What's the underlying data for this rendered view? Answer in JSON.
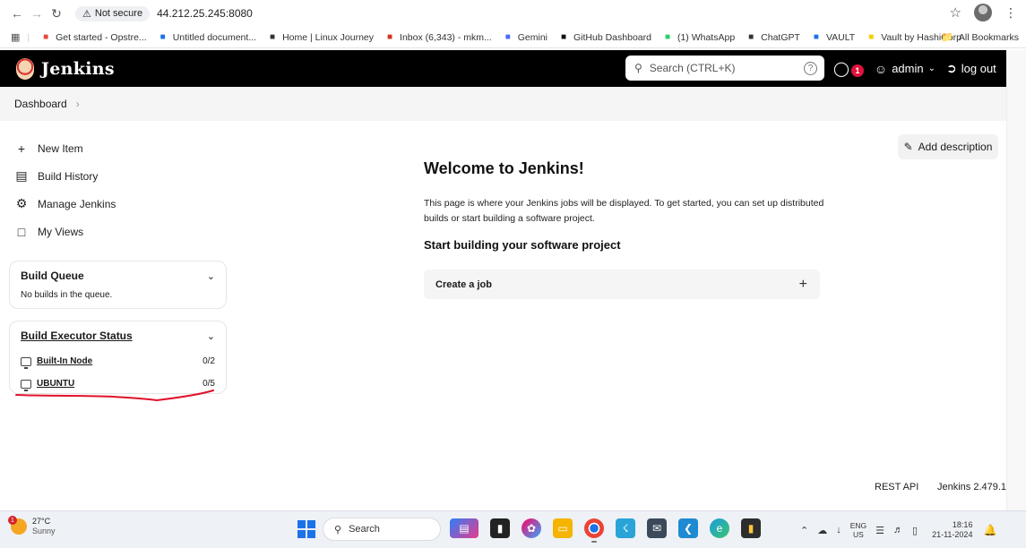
{
  "browser": {
    "security_label": "Not secure",
    "url": "44.212.25.245:8080",
    "bookmarks": [
      {
        "label": "Get started - Opstre...",
        "icon": "opstree-icon",
        "color": "#e64b3c"
      },
      {
        "label": "Untitled document...",
        "icon": "docs-icon",
        "color": "#1a73e8"
      },
      {
        "label": "Home | Linux Journey",
        "icon": "penguin-icon",
        "color": "#333333"
      },
      {
        "label": "Inbox (6,343) - mkm...",
        "icon": "gmail-icon",
        "color": "#d93025"
      },
      {
        "label": "Gemini",
        "icon": "gemini-icon",
        "color": "#4b6bfb"
      },
      {
        "label": "GitHub Dashboard",
        "icon": "github-icon",
        "color": "#111111"
      },
      {
        "label": "(1) WhatsApp",
        "icon": "whatsapp-icon",
        "color": "#25d366"
      },
      {
        "label": "ChatGPT",
        "icon": "chatgpt-icon",
        "color": "#333333"
      },
      {
        "label": "VAULT",
        "icon": "docs-icon",
        "color": "#1a73e8"
      },
      {
        "label": "Vault by HashiCorp",
        "icon": "vault-icon",
        "color": "#f5d000"
      }
    ],
    "all_bookmarks": "All Bookmarks"
  },
  "jenkins": {
    "title": "Jenkins",
    "search_placeholder": "Search (CTRL+K)",
    "alert_count": "1",
    "user": "admin",
    "logout": "log out",
    "breadcrumb": "Dashboard",
    "tasks": [
      {
        "label": "New Item",
        "icon": "plus-icon"
      },
      {
        "label": "Build History",
        "icon": "history-icon"
      },
      {
        "label": "Manage Jenkins",
        "icon": "gear-icon"
      },
      {
        "label": "My Views",
        "icon": "window-icon"
      }
    ],
    "build_queue": {
      "title": "Build Queue",
      "empty": "No builds in the queue."
    },
    "executors": {
      "title": "Build Executor Status",
      "nodes": [
        {
          "name": "Built-In Node",
          "usage": "0/2"
        },
        {
          "name": "UBUNTU",
          "usage": "0/5"
        }
      ]
    },
    "add_description": "Add description",
    "welcome": "Welcome to Jenkins!",
    "intro": "This page is where your Jenkins jobs will be displayed. To get started, you can set up distributed builds or start building a software project.",
    "start_heading": "Start building your software project",
    "create_job": "Create a job",
    "footer": {
      "rest_api": "REST API",
      "version": "Jenkins 2.479.1"
    },
    "annotation_color": "#e0122b"
  },
  "taskbar": {
    "temperature": "27°C",
    "condition": "Sunny",
    "weather_badge": "1",
    "search": "Search",
    "lang_top": "ENG",
    "lang_bottom": "US",
    "time": "18:16",
    "date": "21-11-2024"
  }
}
